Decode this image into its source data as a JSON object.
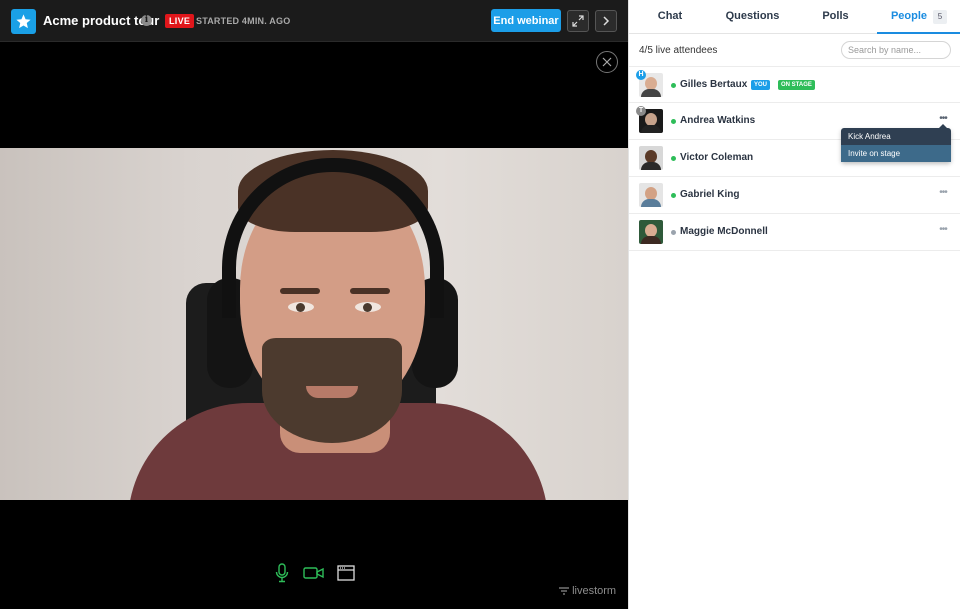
{
  "webinar": {
    "title": "Acme product tour",
    "info_icon": "info-icon",
    "live_label": "LIVE",
    "started_text": "STARTED 4MIN. AGO",
    "end_button": "End webinar"
  },
  "controls": {
    "icons": [
      "microphone-icon",
      "camera-icon",
      "screen-share-icon"
    ],
    "brand": "livestorm"
  },
  "colors": {
    "accent": "#1c9ee8",
    "live": "#e0161b",
    "online": "#2ebd59",
    "control_green": "#2ebd59"
  },
  "tabs": [
    {
      "label": "Chat"
    },
    {
      "label": "Questions"
    },
    {
      "label": "Polls"
    },
    {
      "label": "People",
      "count": "5"
    }
  ],
  "people": {
    "count_text": "4/5 live attendees",
    "search_placeholder": "Search by name...",
    "list": [
      {
        "name": "Gilles Bertaux",
        "role_badge": "H",
        "you_tag": "YOU",
        "stage_tag": "ON STAGE",
        "online": true
      },
      {
        "name": "Andrea Watkins",
        "role_badge": "T",
        "online": true
      },
      {
        "name": "Victor Coleman",
        "online": true
      },
      {
        "name": "Gabriel King",
        "online": true
      },
      {
        "name": "Maggie McDonnell",
        "online": false
      }
    ],
    "menu": {
      "kick": "Kick Andrea",
      "invite": "Invite on stage"
    }
  }
}
